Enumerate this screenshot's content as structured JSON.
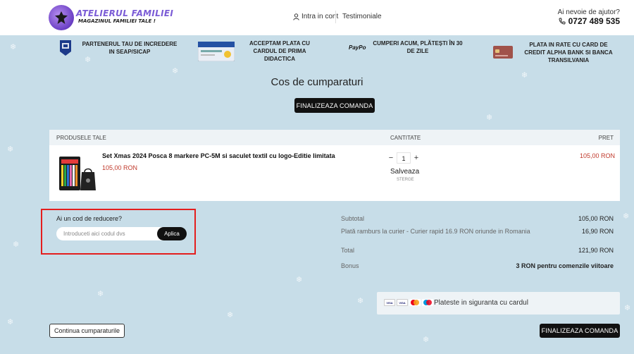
{
  "header": {
    "logo_title": "ATELIERUL FAMILIEI",
    "logo_subtitle": "MAGAZINUL FAMILIEI TALE !",
    "account_label": "Intra in cont",
    "testimonials_label": "Testimoniale",
    "help_label": "Ai nevoie de ajutor?",
    "phone": "0727 489 535"
  },
  "benefits": [
    {
      "text": "PARTENERUL TAU DE INCREDERE IN SEAP/SICAP",
      "icon": "seap-logo-icon"
    },
    {
      "text": "ACCEPTAM PLATA CU CARDUL DE PRIMA DIDACTICA",
      "icon": "card-prima-didactica-icon"
    },
    {
      "text": "CUMPERI ACUM, PLĂTEȘTI ÎN 30 DE ZILE",
      "icon": "paypo-logo-icon",
      "logo_text": "PayPo"
    },
    {
      "text": "PLATA IN RATE CU CARD DE CREDIT ALPHA BANK SI BANCA TRANSILVANIA",
      "icon": "credit-card-icon"
    }
  ],
  "page": {
    "title": "Cos de cumparaturi",
    "checkout_label": "FINALIZEAZA COMANDA"
  },
  "cart": {
    "headers": {
      "product": "PRODUSELE TALE",
      "quantity": "CANTITATE",
      "price": "PRET"
    },
    "items": [
      {
        "name": "Set Xmas 2024 Posca 8 markere PC-5M si saculet textil cu logo-Editie limitata",
        "unit_price": "105,00 RON",
        "quantity": "1",
        "save_label": "Salveaza",
        "remove_label": "STERGE",
        "total_price": "105,00 RON"
      }
    ]
  },
  "coupon": {
    "label": "Ai un cod de reducere?",
    "placeholder": "Introduceti aici codul dvs",
    "apply_label": "Aplica"
  },
  "totals": {
    "subtotal_label": "Subtotal",
    "subtotal_value": "105,00 RON",
    "shipping_label": "Plată ramburs la curier - Curier rapid 16.9 RON oriunde in Romania",
    "shipping_value": "16,90 RON",
    "total_label": "Total",
    "total_value": "121,90 RON",
    "bonus_label": "Bonus",
    "bonus_value": "3 RON pentru comenzile viitoare"
  },
  "secure_payment": {
    "text": "Plateste in siguranta cu cardul",
    "cards": [
      "VISA",
      "VISA",
      "MC",
      "MAESTRO"
    ]
  },
  "footer": {
    "continue_label": "Continua cumparaturile",
    "checkout_label": "FINALIZEAZA COMANDA"
  },
  "colors": {
    "background": "#c7dde8",
    "accent_price": "#c0392b",
    "button_dark": "#111111",
    "highlight_box": "#e41e1e"
  }
}
